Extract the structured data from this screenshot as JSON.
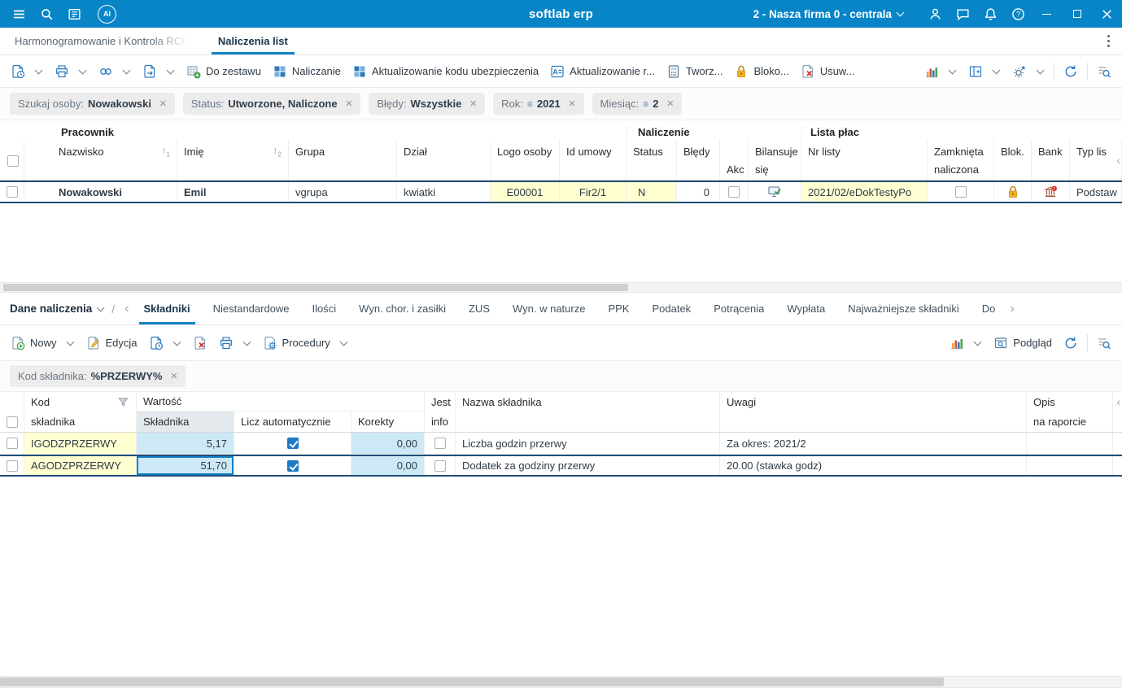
{
  "titlebar": {
    "app_title": "softlab erp",
    "ai_badge": "AI",
    "company_selector": "2 - Nasza firma 0 - centrala"
  },
  "window_tabs": {
    "tab1": "Harmonogramowanie i Kontrola RCP",
    "tab2": "Naliczenia list"
  },
  "toolbar_main": {
    "do_zestawu": "Do zestawu",
    "naliczanie": "Naliczanie",
    "aktualizowanie_kodu": "Aktualizowanie kodu ubezpieczenia",
    "aktualizowanie_r": "Aktualizowanie r...",
    "tworz": "Tworz...",
    "bloko": "Bloko...",
    "usuw": "Usuw..."
  },
  "filters_main": {
    "chips": [
      {
        "label": "Szukaj osoby:",
        "value": "Nowakowski"
      },
      {
        "label": "Status:",
        "value": "Utworzone, Naliczone"
      },
      {
        "label": "Błędy:",
        "value": "Wszystkie"
      },
      {
        "label": "Rok:",
        "value": "2021"
      },
      {
        "label": "Miesiąc:",
        "value": "2"
      }
    ]
  },
  "grid1": {
    "groups": {
      "pracownik": "Pracownik",
      "naliczenie": "Naliczenie",
      "lista_plac": "Lista płac"
    },
    "columns": {
      "nazwisko": "Nazwisko",
      "imie": "Imię",
      "grupa": "Grupa",
      "dzial": "Dział",
      "logo_osoby": "Logo osoby",
      "id_umowy": "Id umowy",
      "status": "Status",
      "bledy": "Błędy",
      "akc": "Akc",
      "bilansuje_1": "Bilansuje",
      "bilansuje_2": "się",
      "nr_listy": "Nr listy",
      "zamknieta_1": "Zamknięta",
      "zamknieta_2": "naliczona",
      "blok": "Blok.",
      "bank": "Bank",
      "typ_listy": "Typ lis"
    },
    "sort1": "1",
    "sort2": "2",
    "row": {
      "nazwisko": "Nowakowski",
      "imie": "Emil",
      "grupa": "vgrupa",
      "dzial": "kwiatki",
      "logo_osoby": "E00001",
      "id_umowy": "Fir2/1",
      "status": "N",
      "bledy": "0",
      "akc_checked": false,
      "bilansuje_sie_icon": "monitor-check-icon",
      "nr_listy": "2021/02/eDokTestyPo",
      "zamknieta_checked": false,
      "blok_icon": "lock-icon",
      "bank_icon": "bank-alert-icon",
      "typ_listy": "Podstaw"
    }
  },
  "section2": {
    "title": "Dane naliczenia",
    "tabs": [
      "Składniki",
      "Niestandardowe",
      "Ilości",
      "Wyn. chor. i zasiłki",
      "ZUS",
      "Wyn. w naturze",
      "PPK",
      "Podatek",
      "Potrącenia",
      "Wypłata",
      "Najważniejsze składniki",
      "Do"
    ],
    "active_tab": "Składniki"
  },
  "toolbar_sub": {
    "nowy": "Nowy",
    "edycja": "Edycja",
    "procedury": "Procedury",
    "podglad": "Podgląd"
  },
  "filters_sub": {
    "chip": {
      "label": "Kod składnika:",
      "value": "%PRZERWY%"
    }
  },
  "grid2": {
    "columns": {
      "kod_1": "Kod",
      "kod_2": "składnika",
      "wartosc_group": "Wartość",
      "skladnika": "Składnika",
      "licz_automatycznie": "Licz automatycznie",
      "korekty": "Korekty",
      "jest_1": "Jest",
      "jest_2": "info",
      "nazwa": "Nazwa składnika",
      "uwagi": "Uwagi",
      "opis_1": "Opis",
      "opis_2": "na raporcie"
    },
    "rows": [
      {
        "kod": "IGODZPRZERWY",
        "wartosc": "5,17",
        "licz_automatycznie": true,
        "korekty": "0,00",
        "jest_info": false,
        "nazwa": "Liczba godzin przerwy",
        "uwagi": "Za okres: 2021/2",
        "opis": ""
      },
      {
        "kod": "AGODZPRZERWY",
        "wartosc": "51,70",
        "licz_automatycznie": true,
        "korekty": "0,00",
        "jest_info": false,
        "nazwa": "Dodatek za godziny przerwy",
        "uwagi": "20.00 (stawka godz)",
        "opis": ""
      }
    ]
  },
  "icons": {
    "hamburger-menu-icon": "three horizontal lines",
    "search-icon": "magnifier",
    "contacts-icon": "card with lines",
    "person-icon": "user silhouette",
    "chat-icon": "speech bubble",
    "bell-icon": "notification bell",
    "help-icon": "question mark circle",
    "lock-icon": "yellow padlock",
    "delete-document-icon": "document with red x",
    "chart-icon": "colored bar chart",
    "refresh-icon": "circular arrow",
    "monitor-check-icon": "screen with green check",
    "bank-alert-icon": "bank building with red exclamation",
    "filter-icon": "funnel"
  },
  "colors": {
    "titlebar": "#0885c6",
    "accent": "#1581c6",
    "cell_yellow": "#ffffd2",
    "cell_blue": "#cde9f6",
    "selection_border": "#1f4e79",
    "checkbox_checked": "#1e7ac4"
  }
}
